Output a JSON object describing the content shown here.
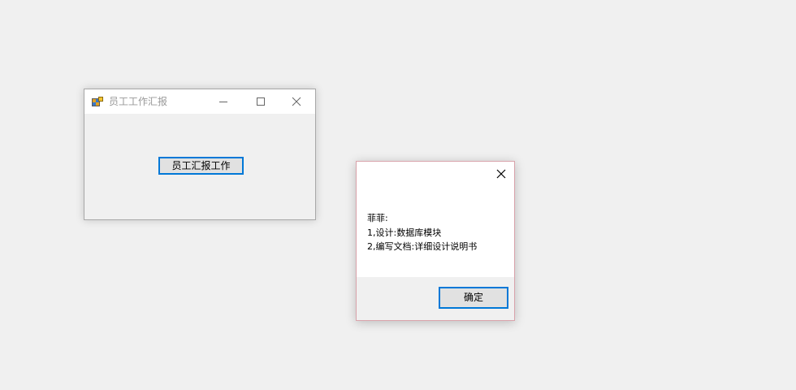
{
  "main_window": {
    "title": "员工工作汇报",
    "icon": "windows-form-icon",
    "report_button_label": "员工汇报工作"
  },
  "message_box": {
    "lines": [
      "菲菲:",
      "1,设计:数据库模块",
      "2,编写文档:详细设计说明书"
    ],
    "ok_label": "确定"
  },
  "colors": {
    "desktop": "#f0f0f0",
    "focus_border": "#0078d7",
    "button_face": "#e1e1e1",
    "msgbox_border": "#d9a3ab"
  }
}
